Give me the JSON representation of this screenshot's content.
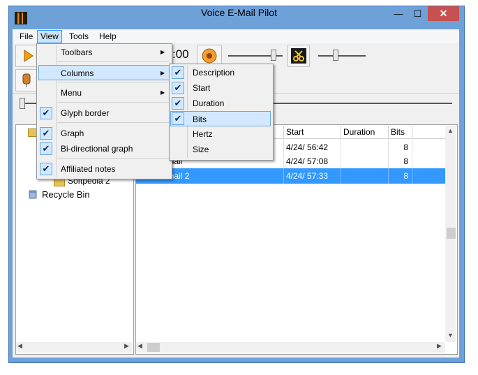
{
  "window": {
    "title": "Voice E-Mail Pilot",
    "close_glyph": "✕",
    "minimize_glyph": "—",
    "maximize_glyph": "☐"
  },
  "menubar": {
    "items": [
      "File",
      "View",
      "Tools",
      "Help"
    ]
  },
  "toolbar": {
    "time_display": ":00"
  },
  "view_menu": {
    "items": [
      {
        "label": "Toolbars",
        "checked": false,
        "submenu": true
      },
      {
        "label": "Columns",
        "checked": false,
        "submenu": true
      },
      {
        "label": "Menu",
        "checked": false,
        "submenu": true
      },
      {
        "label": "Glyph border",
        "checked": true,
        "submenu": false
      },
      {
        "label": "Graph",
        "checked": true,
        "submenu": false
      },
      {
        "label": "Bi-directional graph",
        "checked": true,
        "submenu": false
      },
      {
        "label": "Affiliated notes",
        "checked": true,
        "submenu": false
      }
    ]
  },
  "columns_submenu": {
    "items": [
      {
        "label": "Description",
        "checked": true
      },
      {
        "label": "Start",
        "checked": true
      },
      {
        "label": "Duration",
        "checked": true
      },
      {
        "label": "Bits",
        "checked": true
      },
      {
        "label": "Hertz",
        "checked": false
      },
      {
        "label": "Size",
        "checked": false
      }
    ]
  },
  "tree": {
    "items": [
      "Softpedia 2",
      "Recycle Bin"
    ]
  },
  "list": {
    "columns": [
      "Start",
      "Duration",
      "Bits"
    ],
    "rows": [
      {
        "description": "",
        "start": "4/24/ 56:42",
        "duration": "",
        "bits": "8"
      },
      {
        "description": "a voice mail",
        "start": "4/24/ 57:08",
        "duration": "",
        "bits": "8"
      },
      {
        "description": "a voice mail 2",
        "start": "4/24/ 57:33",
        "duration": "",
        "bits": "8"
      }
    ]
  },
  "glyphs": {
    "check": "✔",
    "submenu_arrow": "▶",
    "scroll_up": "▲",
    "scroll_down": "▼",
    "scroll_left": "◀",
    "scroll_right": "▶"
  },
  "colors": {
    "selection": "#3399ff",
    "frame": "#6fa1d9",
    "close": "#c75050",
    "menu_highlight": "#d1e8ff"
  }
}
